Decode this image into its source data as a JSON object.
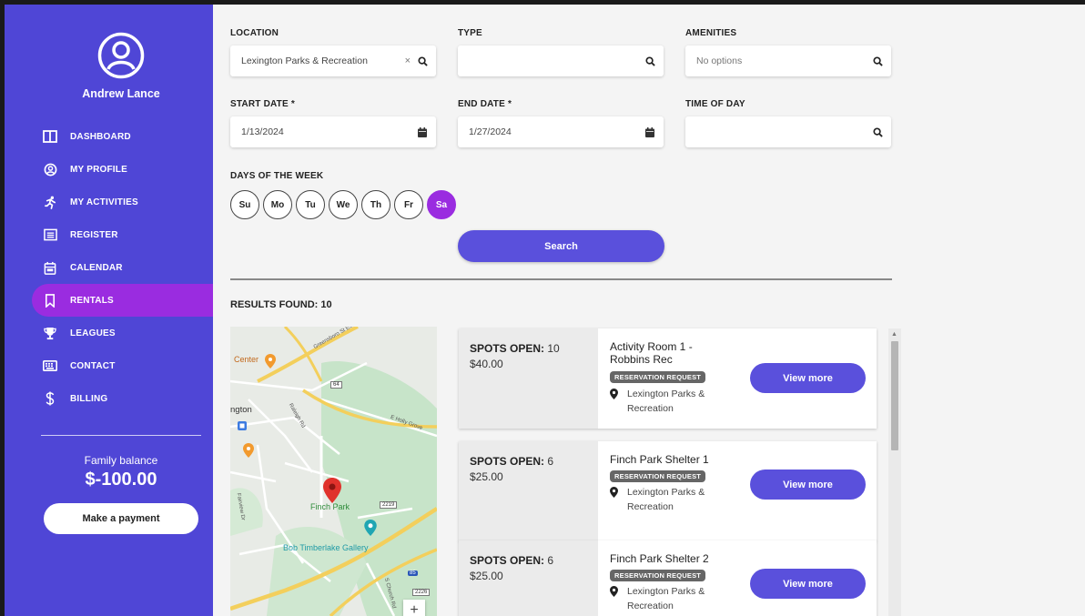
{
  "user": {
    "name": "Andrew Lance"
  },
  "nav": [
    {
      "label": "DASHBOARD",
      "icon": "book-icon"
    },
    {
      "label": "MY PROFILE",
      "icon": "user-circle-icon"
    },
    {
      "label": "MY ACTIVITIES",
      "icon": "runner-icon"
    },
    {
      "label": "REGISTER",
      "icon": "list-icon"
    },
    {
      "label": "CALENDAR",
      "icon": "calendar-icon"
    },
    {
      "label": "RENTALS",
      "icon": "bookmark-icon",
      "active": true
    },
    {
      "label": "LEAGUES",
      "icon": "trophy-icon"
    },
    {
      "label": "CONTACT",
      "icon": "keyboard-icon"
    },
    {
      "label": "BILLING",
      "icon": "dollar-icon"
    }
  ],
  "balance": {
    "label": "Family balance",
    "value": "$-100.00",
    "pay_label": "Make a payment"
  },
  "filters": {
    "location_label": "LOCATION",
    "location_value": "Lexington Parks & Recreation",
    "location_clear": "×",
    "type_label": "TYPE",
    "type_value": "",
    "amenities_label": "AMENITIES",
    "amenities_placeholder": "No options",
    "start_label": "START DATE *",
    "start_value": "1/13/2024",
    "end_label": "END DATE *",
    "end_value": "1/27/2024",
    "time_label": "TIME OF DAY",
    "time_value": "",
    "days_label": "DAYS OF THE WEEK",
    "days": [
      "Su",
      "Mo",
      "Tu",
      "We",
      "Th",
      "Fr",
      "Sa"
    ],
    "selected_day": "Sa",
    "search_label": "Search"
  },
  "results": {
    "label": "RESULTS FOUND: 10",
    "items": [
      {
        "spots_label": "SPOTS OPEN:",
        "spots": "10",
        "price": "$40.00",
        "name": "Activity Room 1 - Robbins Rec",
        "badge": "RESERVATION REQUEST",
        "location": "Lexington Parks & Recreation",
        "button": "View more"
      },
      {
        "spots_label": "SPOTS OPEN:",
        "spots": "6",
        "price": "$25.00",
        "name": "Finch Park Shelter 1",
        "badge": "RESERVATION REQUEST",
        "location": "Lexington Parks & Recreation",
        "button": "View more"
      },
      {
        "spots_label": "SPOTS OPEN:",
        "spots": "6",
        "price": "$25.00",
        "name": "Finch Park Shelter 2",
        "badge": "RESERVATION REQUEST",
        "location": "Lexington Parks & Recreation",
        "button": "View more"
      }
    ]
  },
  "map": {
    "labels": {
      "center": "Center",
      "lexington": "ngton",
      "finch_park": "Finch Park",
      "gallery": "Bob Timberlake Gallery",
      "greensboro": "Greensboro St Ext",
      "raleigh": "Raleigh Rd",
      "holly": "E Holly Grove",
      "fairview": "Fairview Dr",
      "church": "S Church Rd",
      "route_64": "64",
      "route_2219": "2219",
      "route_2226": "2226",
      "route_85": "85",
      "zoom_in": "+"
    }
  },
  "colors": {
    "sidebar": "#4f46d6",
    "accent": "#9a2ce0",
    "button": "#5a50dc"
  }
}
